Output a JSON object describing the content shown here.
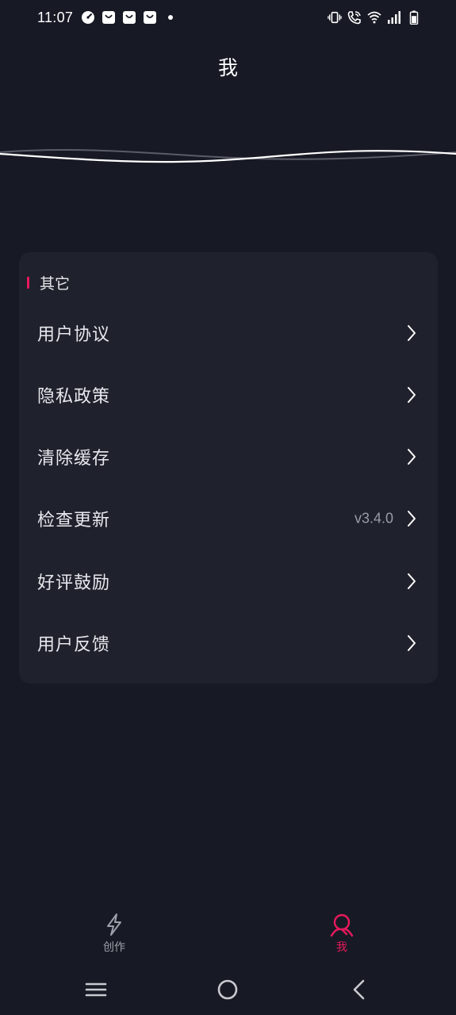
{
  "status_bar": {
    "time": "11:07",
    "left_icons": [
      "speedometer-icon",
      "shopping-bag-icon",
      "shopping-bag-icon",
      "shopping-bag-icon",
      "dot-icon"
    ],
    "right_icons": [
      "vibrate-icon",
      "wifi-call-icon",
      "wifi-icon",
      "signal-icon",
      "battery-icon"
    ]
  },
  "header": {
    "title": "我"
  },
  "section": {
    "title": "其它",
    "accent_color": "#e8195d",
    "items": [
      {
        "label": "用户协议",
        "value": ""
      },
      {
        "label": "隐私政策",
        "value": ""
      },
      {
        "label": "清除缓存",
        "value": ""
      },
      {
        "label": "检查更新",
        "value": "v3.4.0"
      },
      {
        "label": "好评鼓励",
        "value": ""
      },
      {
        "label": "用户反馈",
        "value": ""
      }
    ]
  },
  "bottom_nav": {
    "items": [
      {
        "label": "创作",
        "icon": "lightning-icon",
        "active": false
      },
      {
        "label": "我",
        "icon": "user-icon",
        "active": true
      }
    ]
  },
  "system_nav": {
    "buttons": [
      "menu-icon",
      "home-icon",
      "back-icon"
    ]
  },
  "colors": {
    "background": "#171a24",
    "card": "#1f212c",
    "accent": "#e8195d",
    "text_primary": "#e8e9ee",
    "text_secondary": "#9a9ca6"
  }
}
